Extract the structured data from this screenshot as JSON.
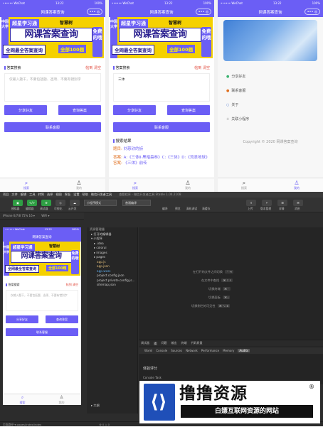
{
  "phones": {
    "status_left": "•••••• WeChat",
    "status_time": "13:22",
    "status_right": "100%",
    "nav_title": "网课答案查询",
    "nav_title_about": "关于",
    "capsule": "••• ◎"
  },
  "banner": {
    "side_text": "中国大学",
    "tag1": "超星学习通",
    "tag2": "智慧树",
    "main": "网课答案查询",
    "right": "免费的哦",
    "low1": "全网最全答案查询",
    "low2": "全部100题"
  },
  "search_card": {
    "title": "答案搜索",
    "links": "帖到 清空",
    "placeholder": "仅输入题干，不要包括题、选项、不要有错别字",
    "query_value": "三体"
  },
  "buttons": {
    "share": "分享好友",
    "query": "查询答案",
    "contact": "联系客服"
  },
  "result": {
    "title": "搜索结果",
    "q_label": "题目:",
    "q_value": "刘慈欣的詩",
    "a_label": "答案:",
    "a_value": "A:《三体Ⅱ·黑暗森林》C:《三体》D:《流浪地球》",
    "more_label": "答案:",
    "more_value": "《三体》前传"
  },
  "tabbar": {
    "search": "搜索",
    "mine": "我的"
  },
  "about": {
    "items": [
      "分享好友",
      "联系客服",
      "关于",
      "关联小程序"
    ],
    "copyright": "Copyright © 2020 网课答案查询"
  },
  "ide": {
    "menu": [
      "项目",
      "文件",
      "编辑",
      "工具",
      "转到",
      "选择",
      "视图",
      "界面",
      "设置",
      "帮助",
      "微信开发者工具"
    ],
    "window_title": "查题程序 · 微信开发者工具 Stable 1.04.2108",
    "toolbar_labels": [
      "模拟器",
      "编辑器",
      "调试器",
      "可视化",
      "云开发"
    ],
    "mode_select": "小程序模式",
    "compile_select": "普通编译",
    "right_labels": [
      "编译",
      "预览",
      "真机调试",
      "清缓存"
    ],
    "far_right_labels": [
      "上传",
      "版本管理",
      "详情",
      "消息"
    ],
    "device": "iPhone 6/7/8 75% 16 ▾",
    "wifi": "WiFi ▾",
    "explorer_title": "资源管理器",
    "explorer_items": [
      "▸ 打开的编辑器",
      "▾ 小程序",
      "▸ .idea",
      "▸ colorui",
      "▸ images",
      "▸ pages",
      "app.js",
      "app.json",
      "app.wxss",
      "project.config.json",
      "project.private.config.js...",
      "sitemap.json"
    ],
    "shortcuts": [
      {
        "label": "在打开的文件之间切换",
        "keys": "⌃ ⇥"
      },
      {
        "label": "在文件中查找",
        "keys": "⌘ ⇧ F"
      },
      {
        "label": "切换终端",
        "keys": "⌘ `"
      },
      {
        "label": "切换面板",
        "keys": "⌘ J"
      },
      {
        "label": "切换侧栏的可见性",
        "keys": "⌘ ⌥ B"
      }
    ],
    "panel_tabs": [
      "调试器",
      "4",
      "问题",
      "输出",
      "终端",
      "代码质量"
    ],
    "dev_tabs": [
      "Wxml",
      "Console",
      "Sources",
      "Network",
      "Performance",
      "Memory",
      "Audits"
    ],
    "dev_active": "Audits",
    "dev_body_title": "体验评分",
    "dev_body_sub": "Console   Task",
    "path": "页面路径 ▾  pages/index/index",
    "outline": "▸ 大纲",
    "status_bottom": "⊗ 0 △ 0"
  },
  "watermark": {
    "title": "撸撸资源",
    "reg": "®",
    "subtitle": "白嫖互联网资源的网站"
  }
}
